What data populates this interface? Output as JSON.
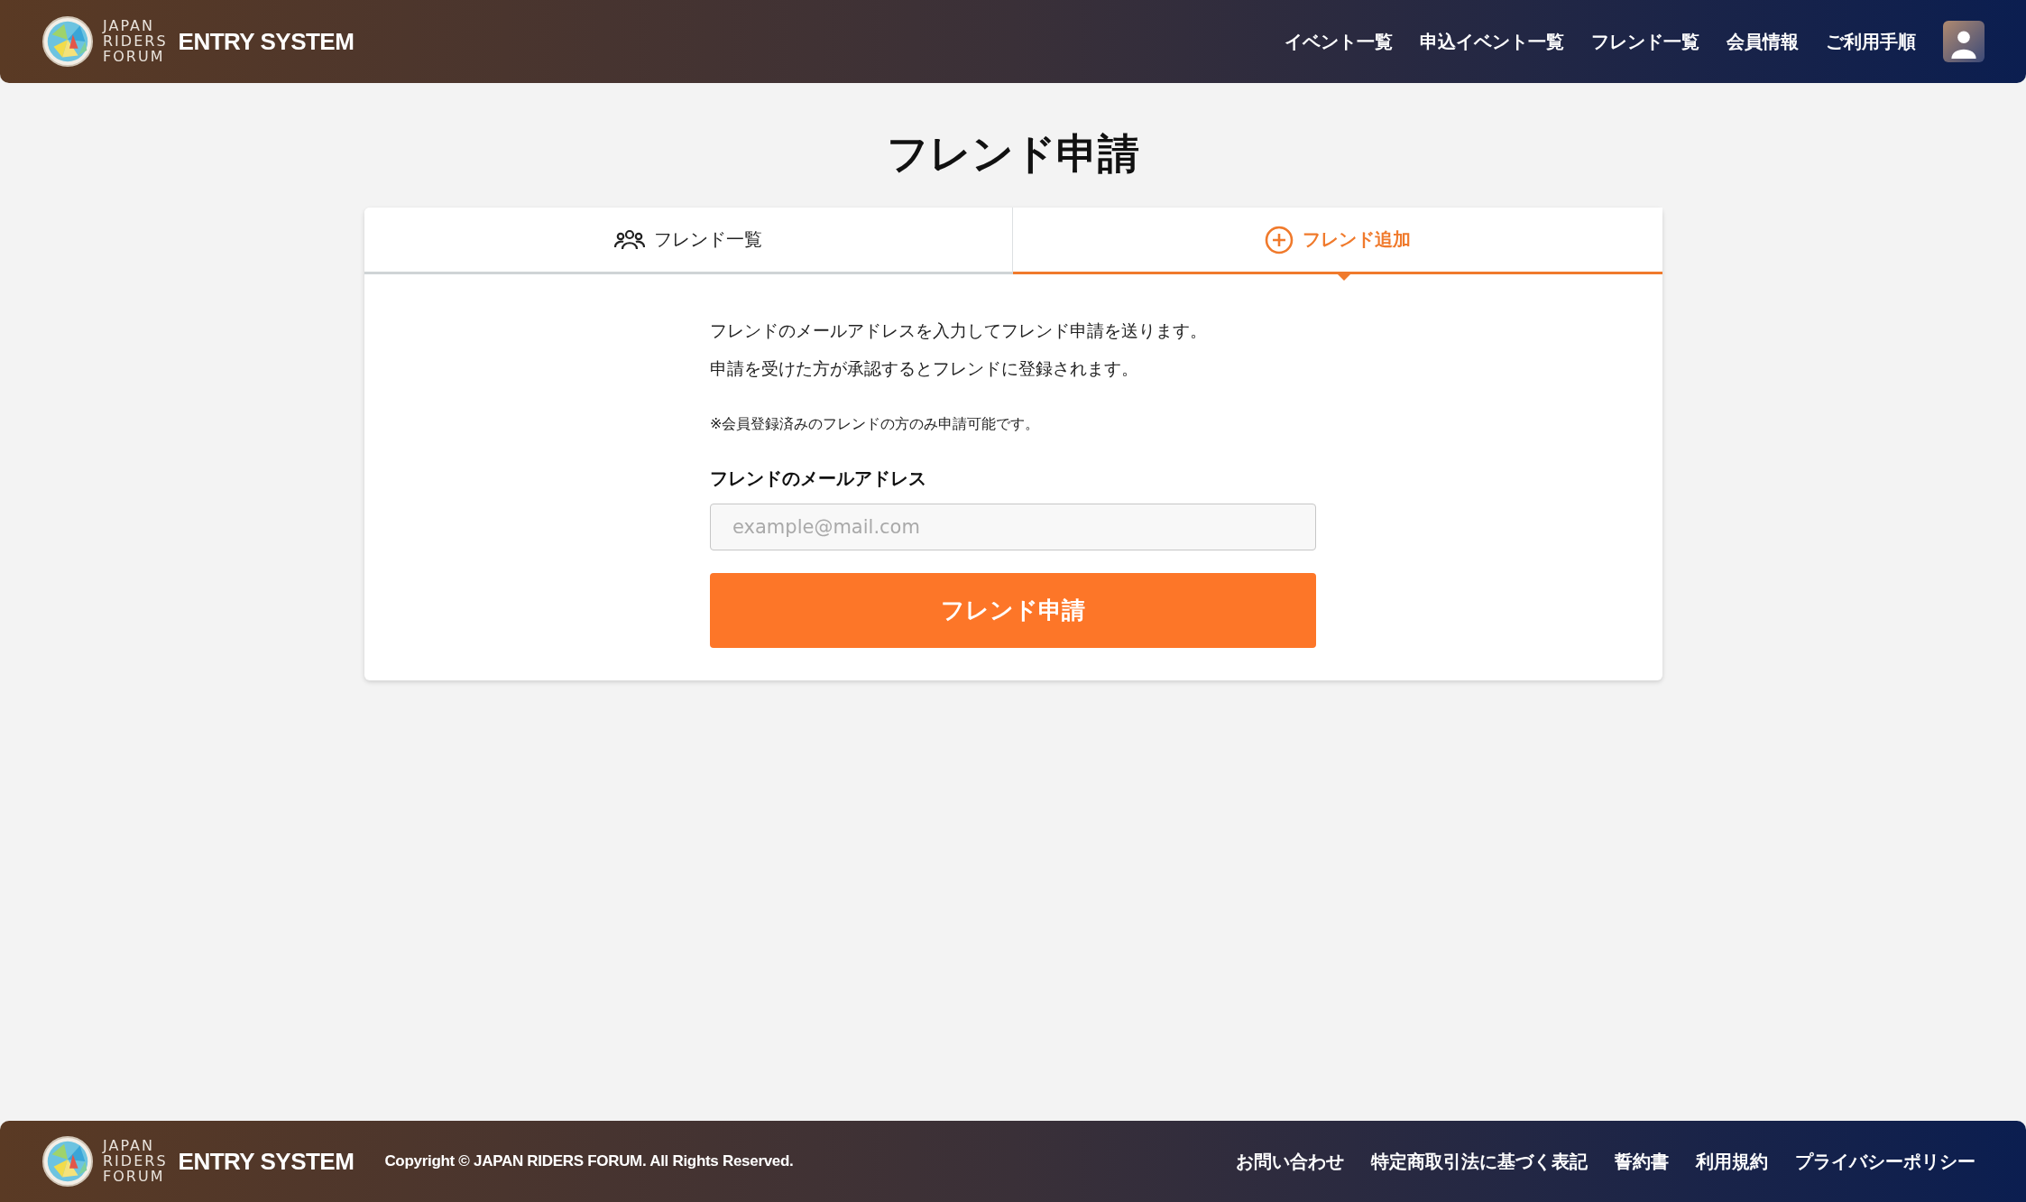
{
  "header": {
    "logo_lines": [
      "JAPAN",
      "RIDERS",
      "FORUM"
    ],
    "brand": "ENTRY SYSTEM",
    "nav": [
      "イベント一覧",
      "申込イベント一覧",
      "フレンド一覧",
      "会員情報",
      "ご利用手順"
    ]
  },
  "title": "フレンド申請",
  "tabs": [
    {
      "label": "フレンド一覧",
      "kind": "people",
      "selected": false
    },
    {
      "label": "フレンド追加",
      "kind": "add",
      "selected": true
    }
  ],
  "form": {
    "intro": [
      "フレンドのメールアドレスを入力してフレンド申請を送ります。",
      "申請を受けた方が承認するとフレンドに登録されます。"
    ],
    "note": "※会員登録済みのフレンドの方のみ申請可能です。",
    "field_label": "フレンドのメールアドレス",
    "placeholder": "example@mail.com",
    "submit": "フレンド申請"
  },
  "footer": {
    "logo_lines": [
      "JAPAN",
      "RIDERS",
      "FORUM"
    ],
    "brand": "ENTRY SYSTEM",
    "copyright": "Copyright © JAPAN RIDERS FORUM. All Rights Reserved.",
    "links": [
      "お問い合わせ",
      "特定商取引法に基づく表記",
      "誓約書",
      "利用規約",
      "プライバシーポリシー"
    ]
  }
}
